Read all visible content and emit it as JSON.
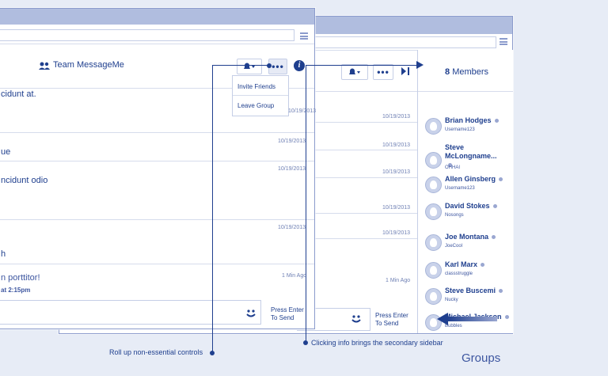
{
  "front": {
    "header_title": "Team MessageMe",
    "menu": {
      "invite": "Invite Friends",
      "leave": "Leave Group"
    },
    "messages": [
      {
        "text": "cidunt at."
      },
      {
        "text": "ue"
      },
      {
        "text": "ncidunt odio"
      },
      {
        "text": "h"
      },
      {
        "text": "n porttitor!",
        "sub": "at 2:15pm"
      }
    ],
    "timestamps": [
      "10/19/2013",
      "10/19/2013",
      "10/19/2013",
      "10/19/2013",
      "1 Min Ago"
    ],
    "press_enter": [
      "Press Enter",
      "To Send"
    ],
    "info_label": "i"
  },
  "back": {
    "timestamps": [
      "10/19/2013",
      "10/19/2013",
      "10/19/2013",
      "10/19/2013",
      "10/19/2013",
      "1 Min Ago"
    ],
    "press_enter": [
      "Press Enter",
      "To Send"
    ],
    "members_count": "8",
    "members_label": "Members",
    "members": [
      {
        "name": "Brian Hodges",
        "handle": "Username123"
      },
      {
        "name": "Steve McLongname...",
        "handle": "OHHAI"
      },
      {
        "name": "Allen Ginsberg",
        "handle": "Username123"
      },
      {
        "name": "David Stokes",
        "handle": "Nosongs"
      },
      {
        "name": "Joe Montana",
        "handle": "JoeCool"
      },
      {
        "name": "Karl Marx",
        "handle": "classstruggle"
      },
      {
        "name": "Steve Buscemi",
        "handle": "Nucky"
      },
      {
        "name": "Michael Jackson",
        "handle": "Bubbles"
      }
    ]
  },
  "annotations": {
    "rollup": "Roll up non-essential controls",
    "info": "Clicking info brings the secondary sidebar"
  },
  "caption": "Groups",
  "colors": {
    "accent": "#1f3f8e",
    "titlebar": "#b0bddf",
    "background": "#e7ecf6"
  }
}
